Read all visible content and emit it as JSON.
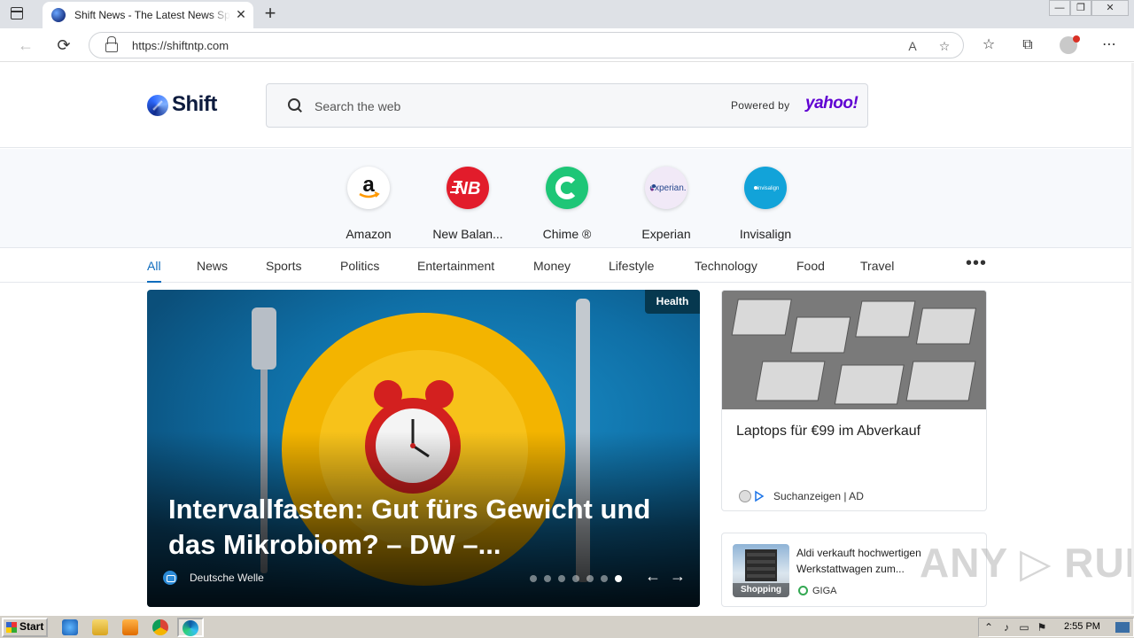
{
  "browser": {
    "tab_title": "Shift News - The Latest News Sports",
    "tab_close": "✕",
    "new_tab": "+",
    "url": "https://shiftntp.com",
    "window_controls": {
      "minimize": "—",
      "restore": "❐",
      "close": "✕"
    },
    "icons": [
      "back-icon",
      "refresh-icon",
      "lock-icon",
      "read-aloud-icon",
      "add-favorite-icon",
      "favorites-icon",
      "collections-icon",
      "profile-icon",
      "more-icon"
    ]
  },
  "header": {
    "logo_text": "Shift",
    "search_placeholder": "Search the web",
    "powered_by": "Powered by",
    "yahoo": "yahoo!"
  },
  "quicklinks": [
    {
      "label": "Amazon",
      "color": "#ffffff"
    },
    {
      "label": "New Balan...",
      "color": "#e21c2b"
    },
    {
      "label": "Chime ®",
      "color": "#1ec677"
    },
    {
      "label": "Experian",
      "color": "#f1e9f7"
    },
    {
      "label": "Invisalign",
      "color": "#12a3d9"
    }
  ],
  "categories": [
    "All",
    "News",
    "Sports",
    "Politics",
    "Entertainment",
    "Money",
    "Lifestyle",
    "Technology",
    "Food",
    "Travel"
  ],
  "more_label": "•••",
  "hero": {
    "badge": "Health",
    "headline": "Intervallfasten: Gut fürs Gewicht und das Mikrobiom? – DW –...",
    "source": "Deutsche Welle",
    "slide_count": 7,
    "active_slide": 7,
    "prev": "←",
    "next": "→"
  },
  "card1": {
    "title": "Laptops für €99 im Abverkauf",
    "ad_label": "Suchanzeigen | AD"
  },
  "card2": {
    "thumb_label": "Shopping",
    "title": "Aldi verkauft hochwertigen Werkstattwagen zum...",
    "source": "GIGA"
  },
  "watermark": "ANY ▷ RUN",
  "taskbar": {
    "start": "Start",
    "clock": "2:55 PM"
  }
}
